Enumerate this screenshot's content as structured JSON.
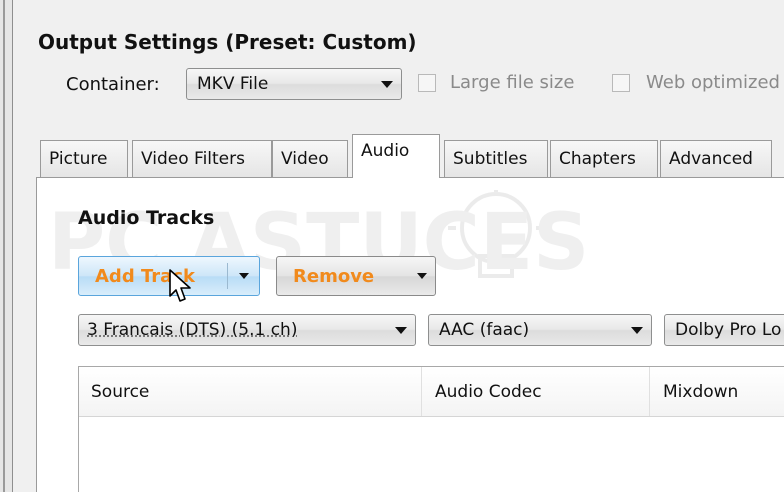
{
  "output_settings": {
    "title": "Output Settings (Preset: Custom)",
    "container_label": "Container:",
    "container_value": "MKV File",
    "large_file_size_label": "Large file size",
    "web_optimized_label": "Web optimized"
  },
  "tabs": [
    {
      "label": "Picture",
      "active": false
    },
    {
      "label": "Video Filters",
      "active": false
    },
    {
      "label": "Video",
      "active": false
    },
    {
      "label": "Audio",
      "active": true
    },
    {
      "label": "Subtitles",
      "active": false
    },
    {
      "label": "Chapters",
      "active": false
    },
    {
      "label": "Advanced",
      "active": false
    }
  ],
  "audio": {
    "tracks_title": "Audio Tracks",
    "add_track_label": "Add Track",
    "remove_label": "Remove",
    "source_track_value": "3 Francais (DTS) (5.1 ch)",
    "codec_value": "AAC (faac)",
    "mixdown_value": "Dolby Pro Lo",
    "columns": [
      "Source",
      "Audio Codec",
      "Mixdown"
    ]
  },
  "watermark": {
    "text": "PC ASTUCES"
  },
  "colors": {
    "button_text": "#f18a1c",
    "add_button_border": "#5aa5dc"
  }
}
